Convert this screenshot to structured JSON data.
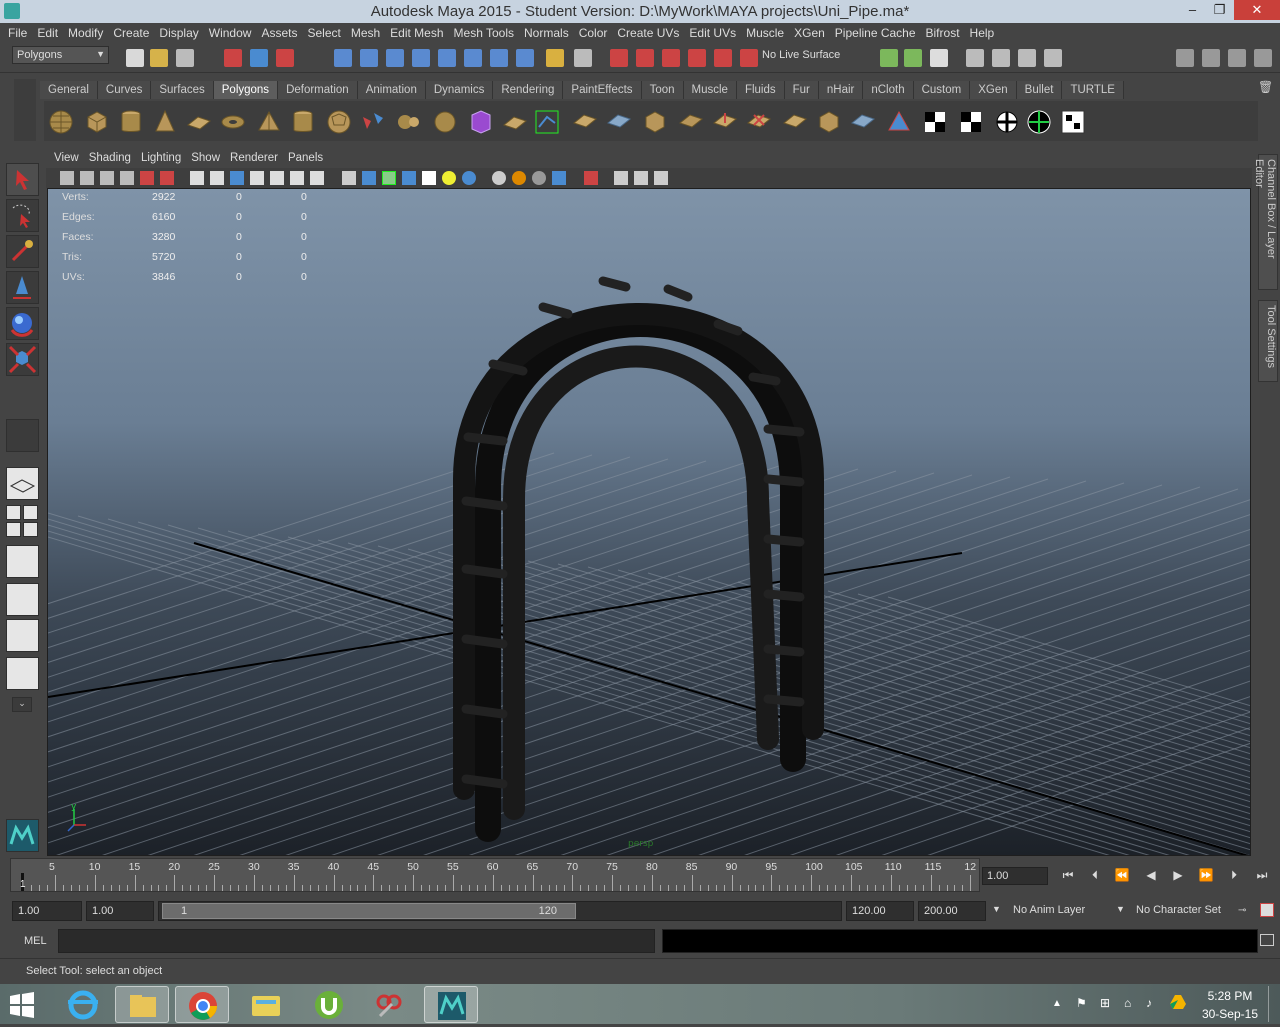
{
  "window": {
    "title": "Autodesk Maya 2015 - Student Version: D:\\MyWork\\MAYA projects\\Uni_Pipe.ma*",
    "controls": [
      "–",
      "❐",
      "✕"
    ]
  },
  "menubar": [
    "File",
    "Edit",
    "Modify",
    "Create",
    "Display",
    "Window",
    "Assets",
    "Select",
    "Mesh",
    "Edit Mesh",
    "Mesh Tools",
    "Normals",
    "Color",
    "Create UVs",
    "Edit UVs",
    "Muscle",
    "XGen",
    "Pipeline Cache",
    "Bifrost",
    "Help"
  ],
  "status_line": {
    "mode": "Polygons",
    "live_surface": "No Live Surface"
  },
  "shelf": {
    "tabs": [
      "General",
      "Curves",
      "Surfaces",
      "Polygons",
      "Deformation",
      "Animation",
      "Dynamics",
      "Rendering",
      "PaintEffects",
      "Toon",
      "Muscle",
      "Fluids",
      "Fur",
      "nHair",
      "nCloth",
      "Custom",
      "XGen",
      "Bullet",
      "TURTLE"
    ],
    "active_tab": "Polygons"
  },
  "panel_menu": [
    "View",
    "Shading",
    "Lighting",
    "Show",
    "Renderer",
    "Panels"
  ],
  "hud": {
    "rows": [
      {
        "label": "Verts:",
        "values": [
          "2922",
          "0",
          "0"
        ]
      },
      {
        "label": "Edges:",
        "values": [
          "6160",
          "0",
          "0"
        ]
      },
      {
        "label": "Faces:",
        "values": [
          "3280",
          "0",
          "0"
        ]
      },
      {
        "label": "Tris:",
        "values": [
          "5720",
          "0",
          "0"
        ]
      },
      {
        "label": "UVs:",
        "values": [
          "3846",
          "0",
          "0"
        ]
      }
    ],
    "camera": "persp"
  },
  "right_tabs": [
    "Channel Box / Layer Editor",
    "Tool Settings"
  ],
  "time_slider": {
    "ticks": [
      "5",
      "10",
      "15",
      "20",
      "25",
      "30",
      "35",
      "40",
      "45",
      "50",
      "55",
      "60",
      "65",
      "70",
      "75",
      "80",
      "85",
      "90",
      "95",
      "100",
      "105",
      "110",
      "115",
      "12"
    ],
    "current_marker": "1",
    "current_frame": "1.00"
  },
  "range": {
    "start_time": "1.00",
    "playback_start": "1.00",
    "range_start": "1",
    "range_end": "120",
    "playback_end": "120.00",
    "end_time": "200.00",
    "anim_layer": "No Anim Layer",
    "character_set": "No Character Set"
  },
  "command_line": {
    "label": "MEL"
  },
  "help_line": "Select Tool: select an object",
  "taskbar": {
    "time": "5:28 PM",
    "date": "30-Sep-15"
  },
  "colors": {
    "accent": "#5d5d5d",
    "close_btn": "#c9403a",
    "select_highlight": "#c33"
  }
}
